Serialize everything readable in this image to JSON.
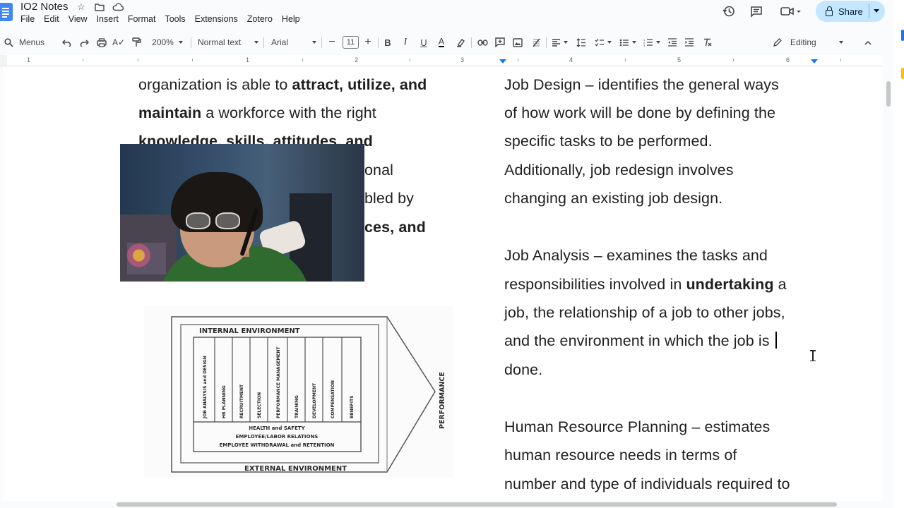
{
  "app": {
    "doc_title": "IO2 Notes",
    "menu": [
      "File",
      "Edit",
      "View",
      "Insert",
      "Format",
      "Tools",
      "Extensions",
      "Zotero",
      "Help"
    ],
    "share_label": "Share",
    "icons": {
      "star": "star-icon",
      "move": "folder-icon",
      "cloud": "cloud-icon",
      "history": "history-icon",
      "comments": "comment-icon",
      "meet": "video-icon"
    }
  },
  "toolbar": {
    "search_label": "Menus",
    "zoom": "200%",
    "style": "Normal text",
    "font": "Arial",
    "font_size": "11",
    "mode": "Editing"
  },
  "ruler": {
    "numbers": [
      "1",
      "1",
      "2",
      "3",
      "4",
      "5",
      "6"
    ]
  },
  "left_column": {
    "line1_a": "organization is able to ",
    "line1_b": "attract, utilize, and",
    "line2_a": "maintain",
    "line2_b": " a workforce with the right",
    "line3": "knowledge, skills, attitudes, and",
    "line4": "onal",
    "line5": "bled by",
    "line6": "ces, and"
  },
  "diagram": {
    "internal": "INTERNAL ENVIRONMENT",
    "external": "EXTERNAL ENVIRONMENT",
    "performance": "PERFORMANCE",
    "columns": [
      "JOB ANALYSIS and DESIGN",
      "HR PLANNING",
      "RECRUITMENT",
      "SELECTION",
      "PERFORMANCE MANAGEMENT",
      "TRAINING",
      "DEVELOPMENT",
      "COMPENSATION",
      "BENEFITS"
    ],
    "bottom": [
      "HEALTH and SAFETY",
      "EMPLOYEE/LABOR RELATIONS",
      "EMPLOYEE WITHDRAWAL and RETENTION"
    ]
  },
  "right_column": {
    "p1": [
      "Job Design – identifies the general ways",
      "of how work will be done by defining the",
      "specific tasks to be performed.",
      "Additionally, job redesign involves",
      "changing an existing job design."
    ],
    "p2_l1": "Job Analysis – examines the tasks and",
    "p2_l2a": "responsibilities involved in ",
    "p2_l2b": "undertaking",
    "p2_l2c": " a",
    "p2_l3": "job, the relationship of a job to other jobs,",
    "p2_l4": "and the environment in which the job is ",
    "p2_l5": "done.",
    "p3": [
      "Human Resource Planning – estimates",
      "human resource needs in terms of",
      "number and type of individuals required to"
    ]
  },
  "colors": {
    "share_bg": "#c2e7ff",
    "doc_blue": "#4285f4",
    "accent": "#1a73e8"
  }
}
